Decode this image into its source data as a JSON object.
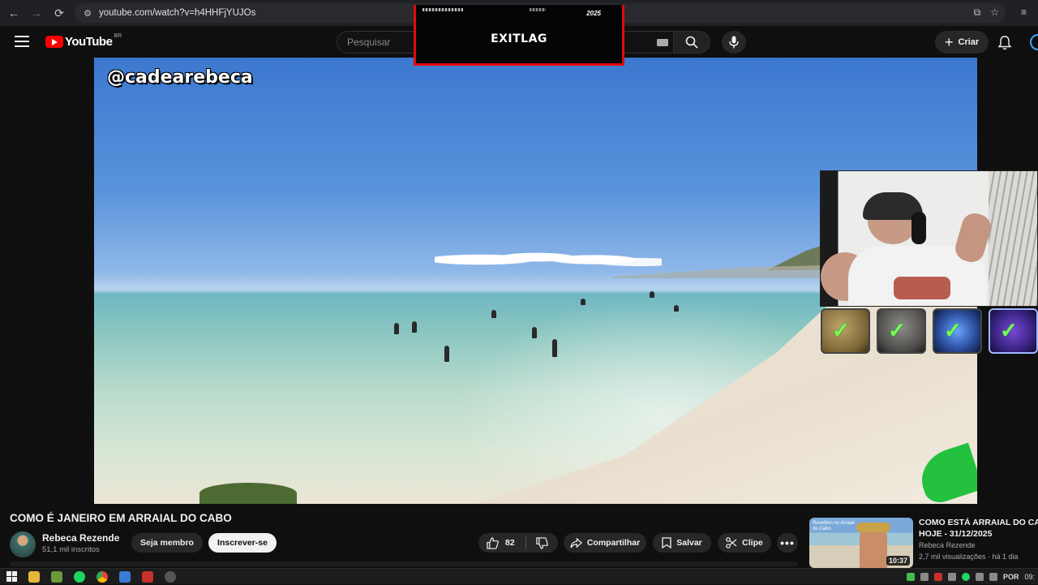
{
  "browser": {
    "url": "youtube.com/watch?v=h4HHFjYUJOs",
    "icons": [
      "back-icon",
      "forward-icon",
      "reload-icon",
      "site-settings-icon",
      "install-app-icon",
      "bookmark-star-icon",
      "reading-list-icon"
    ]
  },
  "header": {
    "logo_text": "YouTube",
    "region": "BR",
    "search_placeholder": "Pesquisar",
    "create_label": "Criar",
    "icons": [
      "hamburger-menu-icon",
      "search-icon",
      "mic-icon",
      "plus-icon",
      "bell-icon",
      "avatar"
    ]
  },
  "overlay": {
    "exitlag_logo": "EXITLAG",
    "exitlag_badge": "2025",
    "watermark": "@cadearebeca",
    "tiles": [
      {
        "checked": true,
        "color": "#c0a56a"
      },
      {
        "checked": true,
        "color": "#8e8c88"
      },
      {
        "checked": true,
        "color": "#6aa4ff"
      },
      {
        "checked": true,
        "color": "#7a48d6"
      }
    ]
  },
  "video": {
    "title": "COMO É JANEIRO EM ARRAIAL DO CABO",
    "channel_name": "Rebeca Rezende",
    "channel_subs": "51,1 mil inscritos",
    "join_label": "Seja membro",
    "subscribe_label": "Inscrever-se",
    "like_count": "82",
    "share_label": "Compartilhar",
    "save_label": "Salvar",
    "clip_label": "Clipe"
  },
  "recommendation": {
    "title_line1": "COMO ESTÁ ARRAIAL DO CABO",
    "title_line2": "HOJE - 31/12/2025",
    "channel": "Rebeca Rezende",
    "meta": "2,7 mil visualizações · há 1 dia",
    "duration": "10:37",
    "thumb_text": "Reveillon no Arraial do Cabo"
  },
  "taskbar": {
    "lang": "POR",
    "time": "09:"
  },
  "colors": {
    "accent": "#ff0000",
    "exitlag_border": "#e10a0a",
    "check": "#7cfa54"
  }
}
